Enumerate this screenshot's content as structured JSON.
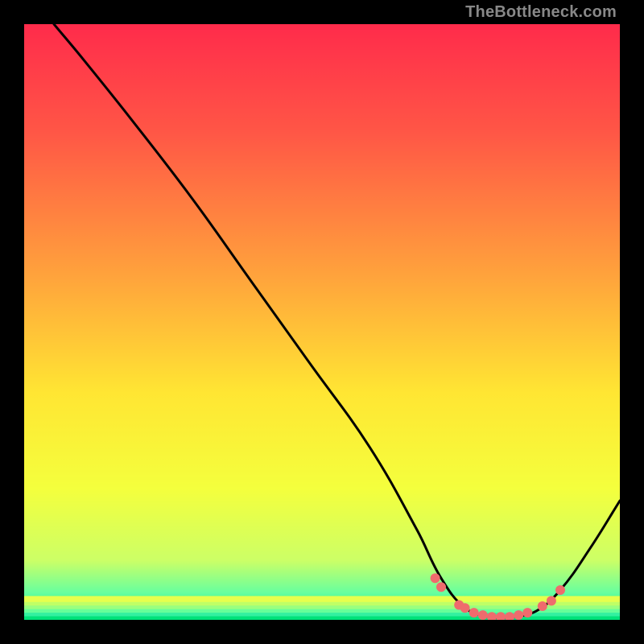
{
  "watermark": "TheBottleneck.com",
  "chart_data": {
    "type": "line",
    "title": "",
    "xlabel": "",
    "ylabel": "",
    "xlim": [
      0,
      100
    ],
    "ylim": [
      0,
      100
    ],
    "background": {
      "gradient_stops": [
        {
          "offset": 0.0,
          "color": "#ff2b4b"
        },
        {
          "offset": 0.18,
          "color": "#ff5646"
        },
        {
          "offset": 0.42,
          "color": "#ffa23c"
        },
        {
          "offset": 0.62,
          "color": "#ffe633"
        },
        {
          "offset": 0.78,
          "color": "#f4ff3d"
        },
        {
          "offset": 0.9,
          "color": "#ccff66"
        },
        {
          "offset": 0.955,
          "color": "#66ff9f"
        },
        {
          "offset": 1.0,
          "color": "#00e27a"
        }
      ],
      "bottom_bands": [
        {
          "y": 0.96,
          "color": "#e6ff4d"
        },
        {
          "y": 0.97,
          "color": "#bfff66"
        },
        {
          "y": 0.976,
          "color": "#99ff7f"
        },
        {
          "y": 0.982,
          "color": "#66ff99"
        },
        {
          "y": 0.988,
          "color": "#33f0a0"
        },
        {
          "y": 0.994,
          "color": "#00e27a"
        }
      ]
    },
    "series": [
      {
        "name": "bottleneck-curve",
        "color": "#000000",
        "width": 3,
        "points": [
          {
            "x": 5.0,
            "y": 100.0
          },
          {
            "x": 10.0,
            "y": 94.0
          },
          {
            "x": 18.0,
            "y": 84.0
          },
          {
            "x": 28.0,
            "y": 71.0
          },
          {
            "x": 38.0,
            "y": 57.0
          },
          {
            "x": 48.0,
            "y": 43.0
          },
          {
            "x": 58.0,
            "y": 29.0
          },
          {
            "x": 66.0,
            "y": 15.0
          },
          {
            "x": 70.0,
            "y": 7.0
          },
          {
            "x": 74.0,
            "y": 2.0
          },
          {
            "x": 78.0,
            "y": 0.5
          },
          {
            "x": 82.0,
            "y": 0.5
          },
          {
            "x": 86.0,
            "y": 1.5
          },
          {
            "x": 90.0,
            "y": 5.0
          },
          {
            "x": 95.0,
            "y": 12.0
          },
          {
            "x": 100.0,
            "y": 20.0
          }
        ]
      }
    ],
    "highlight": {
      "name": "near-zero-points",
      "color": "#ef6b6d",
      "radius": 6,
      "points": [
        {
          "x": 69.0,
          "y": 7.0
        },
        {
          "x": 70.0,
          "y": 5.5
        },
        {
          "x": 73.0,
          "y": 2.5
        },
        {
          "x": 74.0,
          "y": 2.0
        },
        {
          "x": 75.5,
          "y": 1.2
        },
        {
          "x": 77.0,
          "y": 0.8
        },
        {
          "x": 78.5,
          "y": 0.5
        },
        {
          "x": 80.0,
          "y": 0.5
        },
        {
          "x": 81.5,
          "y": 0.5
        },
        {
          "x": 83.0,
          "y": 0.8
        },
        {
          "x": 84.5,
          "y": 1.2
        },
        {
          "x": 87.0,
          "y": 2.3
        },
        {
          "x": 88.5,
          "y": 3.2
        },
        {
          "x": 90.0,
          "y": 5.0
        }
      ]
    }
  },
  "colors": {
    "background_frame": "#000000",
    "curve": "#000000",
    "highlight_points": "#ef6b6d",
    "watermark_text": "#888888"
  }
}
